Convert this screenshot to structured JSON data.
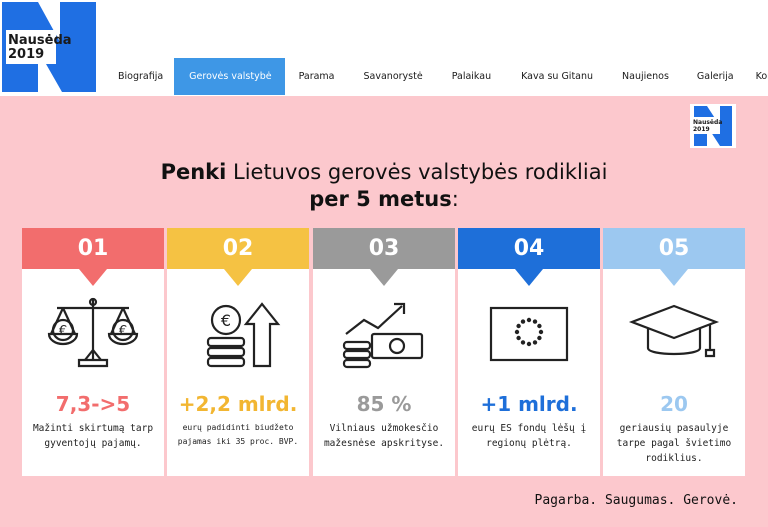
{
  "header": {
    "logo_line1": "Nausėda",
    "logo_line2": "2019",
    "nav": [
      {
        "label": "Biografija",
        "active": false
      },
      {
        "label": "Gerovės valstybė",
        "active": true
      },
      {
        "label": "Parama",
        "active": false
      },
      {
        "label": "Savanorystė",
        "active": false
      },
      {
        "label": "Palaikau",
        "active": false
      },
      {
        "label": "Kava su Gitanu",
        "active": false
      },
      {
        "label": "Naujienos",
        "active": false
      },
      {
        "label": "Galerija",
        "active": false
      },
      {
        "label": "Kontaktai",
        "active": false
      }
    ]
  },
  "banner": {
    "small_logo_line1": "Nausėda",
    "small_logo_line2": "2019",
    "title_bold": "Penki",
    "title_rest": " Lietuvos gerovės valstybės rodikliai",
    "subtitle_bold": "per 5 metus",
    "subtitle_rest": ":",
    "cards": [
      {
        "number": "01",
        "value": "7,3->5",
        "desc": "Mažinti skirtumą tarp gyventojų pajamų.",
        "head_color": "#f26d6d",
        "value_color": "#f26d6d",
        "icon": "scales-icon"
      },
      {
        "number": "02",
        "value": "+2,2 mlrd.",
        "desc": "eurų padidinti biudžeto pajamas iki 35 proc. BVP.",
        "head_color": "#f5c243",
        "value_color": "#f2b632",
        "icon": "euro-coins-arrow-icon"
      },
      {
        "number": "03",
        "value": "85 %",
        "desc": "Vilniaus užmokesčio mažesnėse apskrityse.",
        "head_color": "#9a9a9a",
        "value_color": "#9a9a9a",
        "icon": "money-growth-icon"
      },
      {
        "number": "04",
        "value": "+1 mlrd.",
        "desc": "eurų ES fondų lėšų į regionų plėtrą.",
        "head_color": "#1e6fd9",
        "value_color": "#1e6fd9",
        "icon": "eu-flag-icon"
      },
      {
        "number": "05",
        "value": "20",
        "desc": "geriausių pasaulyje tarpe pagal švietimo rodiklius.",
        "head_color": "#9cc8f0",
        "value_color": "#9cc8f0",
        "icon": "graduation-cap-icon"
      }
    ],
    "footer": "Pagarba. Saugumas. Gerovė."
  }
}
